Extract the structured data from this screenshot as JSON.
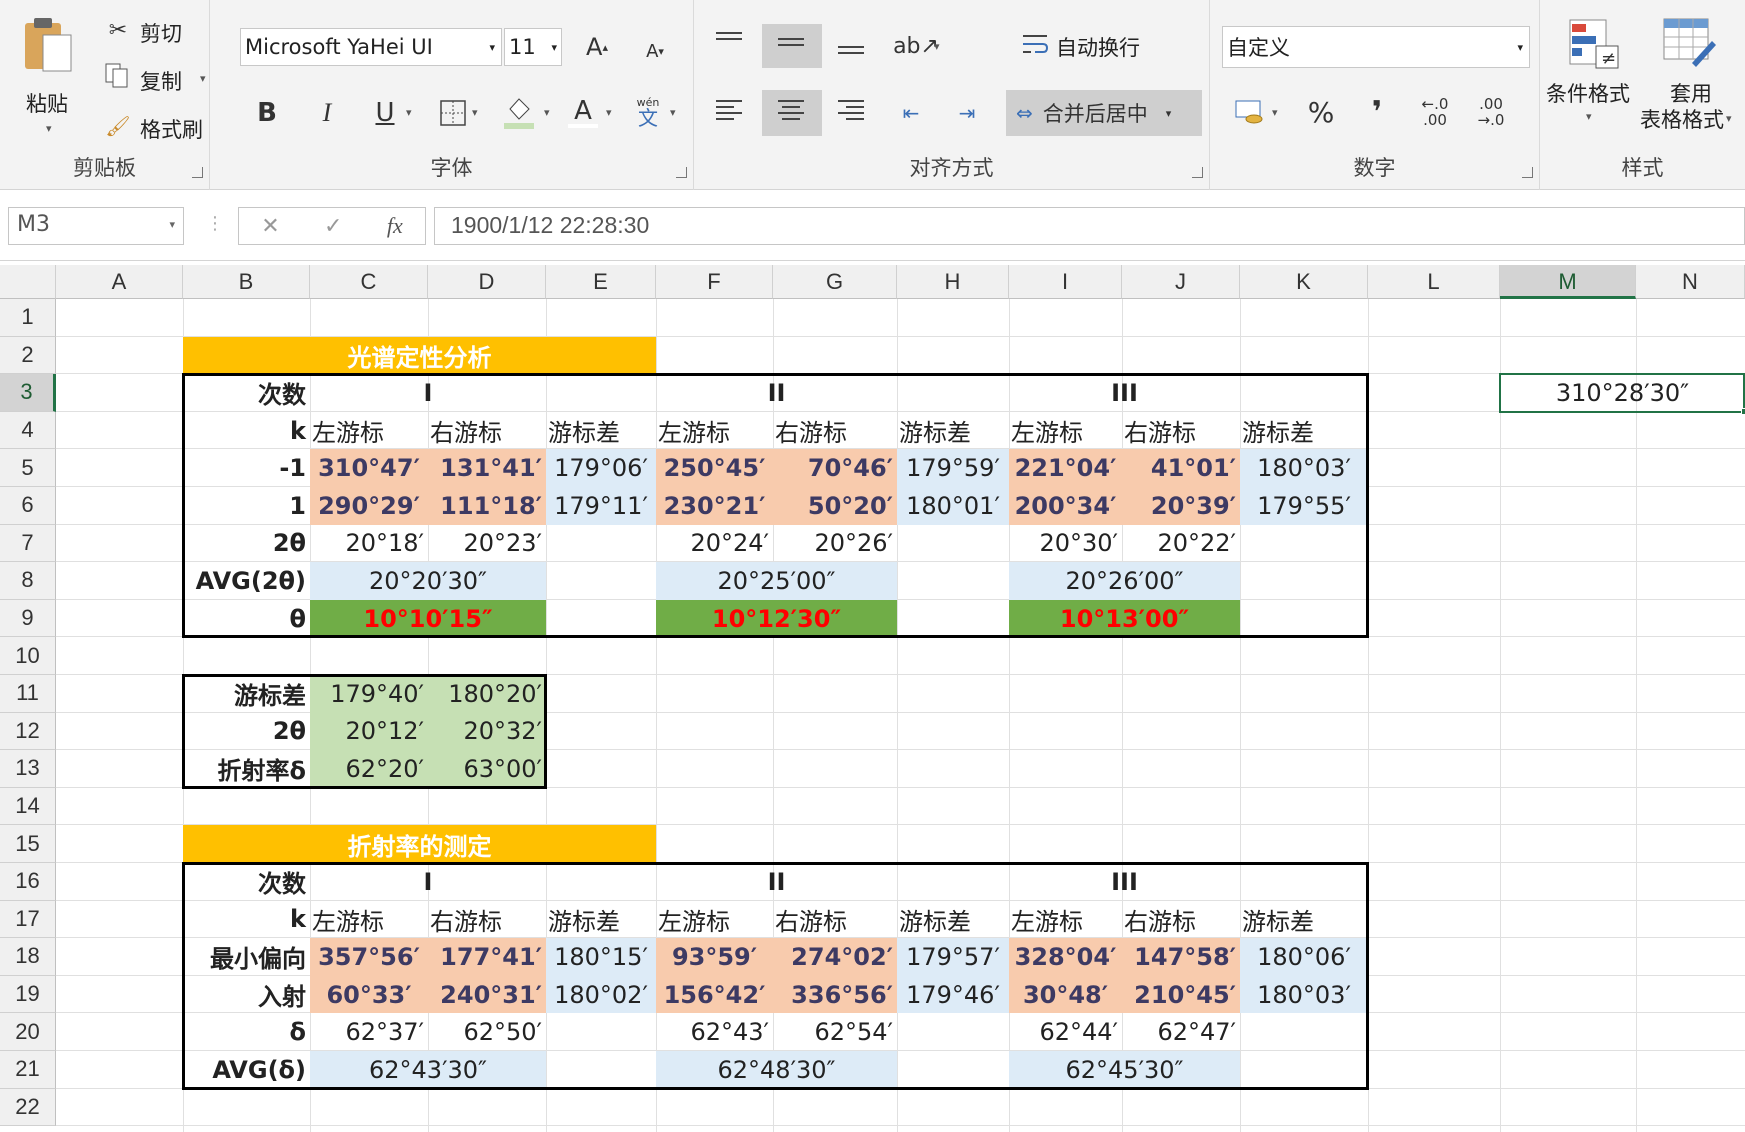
{
  "ribbon": {
    "clipboard": {
      "paste": "粘贴",
      "cut": "剪切",
      "copy": "复制",
      "format_painter": "格式刷",
      "group": "剪贴板"
    },
    "font": {
      "family": "Microsoft YaHei UI",
      "size": "11",
      "group": "字体",
      "pinyin": "wén",
      "pinyin_char": "文"
    },
    "alignment": {
      "wrap": "自动换行",
      "merge": "合并后居中",
      "group": "对齐方式"
    },
    "number": {
      "format": "自定义",
      "percent": "%",
      "comma": "",
      "inc_decimal_top": "←.0",
      "inc_decimal_bottom": ".00",
      "dec_decimal_top": ".00",
      "dec_decimal_bottom": "→.0",
      "group": "数字"
    },
    "styles": {
      "conditional": "条件格式",
      "table_line1": "套用",
      "table_line2": "表格格式",
      "group": "样式"
    }
  },
  "formula_bar": {
    "name_box": "M3",
    "fx": "fx",
    "cancel": "✕",
    "enter": "✓",
    "content": "1900/1/12  22:28:30"
  },
  "columns": [
    "A",
    "B",
    "C",
    "D",
    "E",
    "F",
    "G",
    "H",
    "I",
    "J",
    "K",
    "L",
    "M",
    "N"
  ],
  "rows": [
    "1",
    "2",
    "3",
    "4",
    "5",
    "6",
    "7",
    "8",
    "9",
    "10",
    "11",
    "12",
    "13",
    "14",
    "15",
    "16",
    "17",
    "18",
    "19",
    "20",
    "21",
    "22"
  ],
  "cells": {
    "M3": "310°28′30″",
    "t1": {
      "title": "光谱定性分析",
      "r3": {
        "label": "次数",
        "I": "I",
        "II": "II",
        "III": "III"
      },
      "r4": {
        "label": "k",
        "h": [
          "左游标",
          "右游标",
          "游标差",
          "左游标",
          "右游标",
          "游标差",
          "左游标",
          "右游标",
          "游标差"
        ]
      },
      "r5": {
        "label": "-1",
        "v": [
          "310°47′",
          "131°41′",
          "179°06′",
          "250°45′",
          "70°46′",
          "179°59′",
          "221°04′",
          "41°01′",
          "180°03′"
        ]
      },
      "r6": {
        "label": "1",
        "v": [
          "290°29′",
          "111°18′",
          "179°11′",
          "230°21′",
          "50°20′",
          "180°01′",
          "200°34′",
          "20°39′",
          "179°55′"
        ]
      },
      "r7": {
        "label": "2θ",
        "v": [
          "20°18′",
          "20°23′",
          "20°24′",
          "20°26′",
          "20°30′",
          "20°22′"
        ]
      },
      "r8": {
        "label": "AVG(2θ)",
        "v": [
          "20°20′30″",
          "20°25′00″",
          "20°26′00″"
        ]
      },
      "r9": {
        "label": "θ",
        "v": [
          "10°10′15″",
          "10°12′30″",
          "10°13′00″"
        ]
      }
    },
    "t2": {
      "r11": {
        "label": "游标差",
        "v": [
          "179°40′",
          "180°20′"
        ]
      },
      "r12": {
        "label": "2θ",
        "v": [
          "20°12′",
          "20°32′"
        ]
      },
      "r13": {
        "label": "折射率δ",
        "v": [
          "62°20′",
          "63°00′"
        ]
      }
    },
    "t3": {
      "title": "折射率的测定",
      "r16": {
        "label": "次数",
        "I": "I",
        "II": "II",
        "III": "III"
      },
      "r17": {
        "label": "k",
        "h": [
          "左游标",
          "右游标",
          "游标差",
          "左游标",
          "右游标",
          "游标差",
          "左游标",
          "右游标",
          "游标差"
        ]
      },
      "r18": {
        "label": "最小偏向",
        "v": [
          "357°56′",
          "177°41′",
          "180°15′",
          "93°59′",
          "274°02′",
          "179°57′",
          "328°04′",
          "147°58′",
          "180°06′"
        ]
      },
      "r19": {
        "label": "入射",
        "v": [
          "60°33′",
          "240°31′",
          "180°02′",
          "156°42′",
          "336°56′",
          "179°46′",
          "30°48′",
          "210°45′",
          "180°03′"
        ]
      },
      "r20": {
        "label": "δ",
        "v": [
          "62°37′",
          "62°50′",
          "62°43′",
          "62°54′",
          "62°44′",
          "62°47′"
        ]
      },
      "r21": {
        "label": "AVG(δ)",
        "v": [
          "62°43′30″",
          "62°48′30″",
          "62°45′30″"
        ]
      }
    }
  },
  "colors": {
    "orange": "#f8cbad",
    "blue": "#ddebf7",
    "green": "#70ad47",
    "light_green": "#c6e0b4",
    "yellow": "#ffc000",
    "excel_green": "#217346",
    "red_text": "#ff0000"
  }
}
